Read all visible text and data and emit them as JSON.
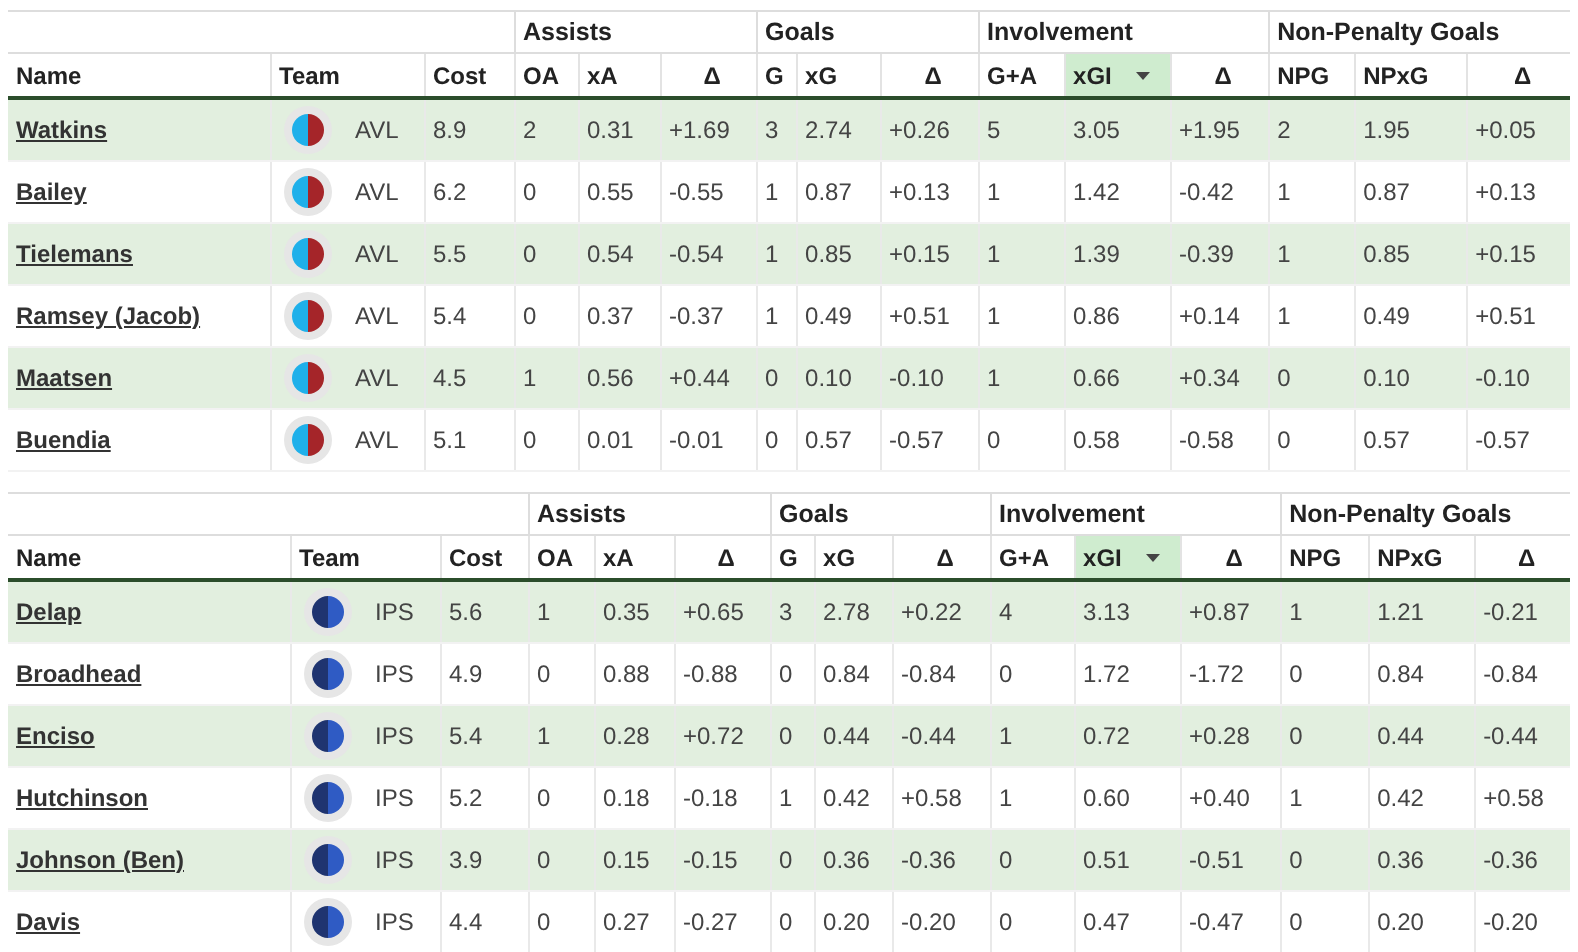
{
  "tables": [
    {
      "team_badge": [
        {
          "color": "#1fb0ea"
        },
        {
          "color": "#a52529"
        }
      ],
      "groups": [
        {
          "columns": [
            {
              "label": "Name",
              "sorted": false
            },
            {
              "label": "Team",
              "sorted": false
            },
            {
              "label": "Cost",
              "sorted": false
            }
          ]
        },
        {
          "label": "Assists",
          "columns": [
            {
              "label": "OA",
              "sorted": false
            },
            {
              "label": "xA",
              "sorted": false
            },
            {
              "label": "Δ",
              "sorted": false
            }
          ]
        },
        {
          "label": "Goals",
          "columns": [
            {
              "label": "G",
              "sorted": false
            },
            {
              "label": "xG",
              "sorted": false
            },
            {
              "label": "Δ",
              "sorted": false
            }
          ]
        },
        {
          "label": "Involvement",
          "columns": [
            {
              "label": "G+A",
              "sorted": false
            },
            {
              "label": "xGI",
              "sorted": true
            },
            {
              "label": "Δ",
              "sorted": false
            }
          ]
        },
        {
          "label": "Non-Penalty Goals",
          "columns": [
            {
              "label": "NPG",
              "sorted": false
            },
            {
              "label": "NPxG",
              "sorted": false
            },
            {
              "label": "Δ",
              "sorted": false
            }
          ]
        }
      ],
      "rows": [
        {
          "name": "Watkins",
          "team": "AVL",
          "values": [
            "8.9",
            "2",
            "0.31",
            "+1.69",
            "3",
            "2.74",
            "+0.26",
            "5",
            "3.05",
            "+1.95",
            "2",
            "1.95",
            "+0.05"
          ]
        },
        {
          "name": "Bailey",
          "team": "AVL",
          "values": [
            "6.2",
            "0",
            "0.55",
            "-0.55",
            "1",
            "0.87",
            "+0.13",
            "1",
            "1.42",
            "-0.42",
            "1",
            "0.87",
            "+0.13"
          ]
        },
        {
          "name": "Tielemans",
          "team": "AVL",
          "values": [
            "5.5",
            "0",
            "0.54",
            "-0.54",
            "1",
            "0.85",
            "+0.15",
            "1",
            "1.39",
            "-0.39",
            "1",
            "0.85",
            "+0.15"
          ]
        },
        {
          "name": "Ramsey (Jacob)",
          "team": "AVL",
          "values": [
            "5.4",
            "0",
            "0.37",
            "-0.37",
            "1",
            "0.49",
            "+0.51",
            "1",
            "0.86",
            "+0.14",
            "1",
            "0.49",
            "+0.51"
          ]
        },
        {
          "name": "Maatsen",
          "team": "AVL",
          "values": [
            "4.5",
            "1",
            "0.56",
            "+0.44",
            "0",
            "0.10",
            "-0.10",
            "1",
            "0.66",
            "+0.34",
            "0",
            "0.10",
            "-0.10"
          ]
        },
        {
          "name": "Buendia",
          "team": "AVL",
          "values": [
            "5.1",
            "0",
            "0.01",
            "-0.01",
            "0",
            "0.57",
            "-0.57",
            "0",
            "0.58",
            "-0.58",
            "0",
            "0.57",
            "-0.57"
          ]
        }
      ]
    },
    {
      "team_badge": [
        {
          "color": "#1f3470"
        },
        {
          "color": "#2f5bc4"
        }
      ],
      "groups": [
        {
          "columns": [
            {
              "label": "Name",
              "sorted": false
            },
            {
              "label": "Team",
              "sorted": false
            },
            {
              "label": "Cost",
              "sorted": false
            }
          ]
        },
        {
          "label": "Assists",
          "columns": [
            {
              "label": "OA",
              "sorted": false
            },
            {
              "label": "xA",
              "sorted": false
            },
            {
              "label": "Δ",
              "sorted": false
            }
          ]
        },
        {
          "label": "Goals",
          "columns": [
            {
              "label": "G",
              "sorted": false
            },
            {
              "label": "xG",
              "sorted": false
            },
            {
              "label": "Δ",
              "sorted": false
            }
          ]
        },
        {
          "label": "Involvement",
          "columns": [
            {
              "label": "G+A",
              "sorted": false
            },
            {
              "label": "xGI",
              "sorted": true
            },
            {
              "label": "Δ",
              "sorted": false
            }
          ]
        },
        {
          "label": "Non-Penalty Goals",
          "columns": [
            {
              "label": "NPG",
              "sorted": false
            },
            {
              "label": "NPxG",
              "sorted": false
            },
            {
              "label": "Δ",
              "sorted": false
            }
          ]
        }
      ],
      "rows": [
        {
          "name": "Delap",
          "team": "IPS",
          "values": [
            "5.6",
            "1",
            "0.35",
            "+0.65",
            "3",
            "2.78",
            "+0.22",
            "4",
            "3.13",
            "+0.87",
            "1",
            "1.21",
            "-0.21"
          ]
        },
        {
          "name": "Broadhead",
          "team": "IPS",
          "values": [
            "4.9",
            "0",
            "0.88",
            "-0.88",
            "0",
            "0.84",
            "-0.84",
            "0",
            "1.72",
            "-1.72",
            "0",
            "0.84",
            "-0.84"
          ]
        },
        {
          "name": "Enciso",
          "team": "IPS",
          "values": [
            "5.4",
            "1",
            "0.28",
            "+0.72",
            "0",
            "0.44",
            "-0.44",
            "1",
            "0.72",
            "+0.28",
            "0",
            "0.44",
            "-0.44"
          ]
        },
        {
          "name": "Hutchinson",
          "team": "IPS",
          "values": [
            "5.2",
            "0",
            "0.18",
            "-0.18",
            "1",
            "0.42",
            "+0.58",
            "1",
            "0.60",
            "+0.40",
            "1",
            "0.42",
            "+0.58"
          ]
        },
        {
          "name": "Johnson (Ben)",
          "team": "IPS",
          "values": [
            "3.9",
            "0",
            "0.15",
            "-0.15",
            "0",
            "0.36",
            "-0.36",
            "0",
            "0.51",
            "-0.51",
            "0",
            "0.36",
            "-0.36"
          ]
        },
        {
          "name": "Davis",
          "team": "IPS",
          "values": [
            "4.4",
            "0",
            "0.27",
            "-0.27",
            "0",
            "0.20",
            "-0.20",
            "0",
            "0.47",
            "-0.47",
            "0",
            "0.20",
            "-0.20"
          ]
        }
      ]
    }
  ]
}
